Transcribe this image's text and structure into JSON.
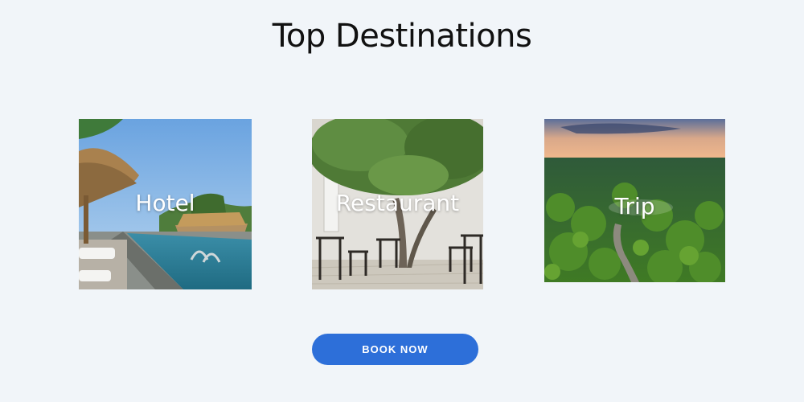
{
  "page": {
    "title": "Top Destinations"
  },
  "destinations": [
    {
      "label": "Hotel",
      "image": "resort-pool-photo"
    },
    {
      "label": "Restaurant",
      "image": "courtyard-tree-tables-photo"
    },
    {
      "label": "Trip",
      "image": "aerial-forest-river-photo"
    }
  ],
  "cta": {
    "label": "BOOK NOW"
  },
  "colors": {
    "background": "#f1f5f9",
    "accent": "#2d6fd9",
    "title": "#111111",
    "card_text": "#ffffff"
  }
}
